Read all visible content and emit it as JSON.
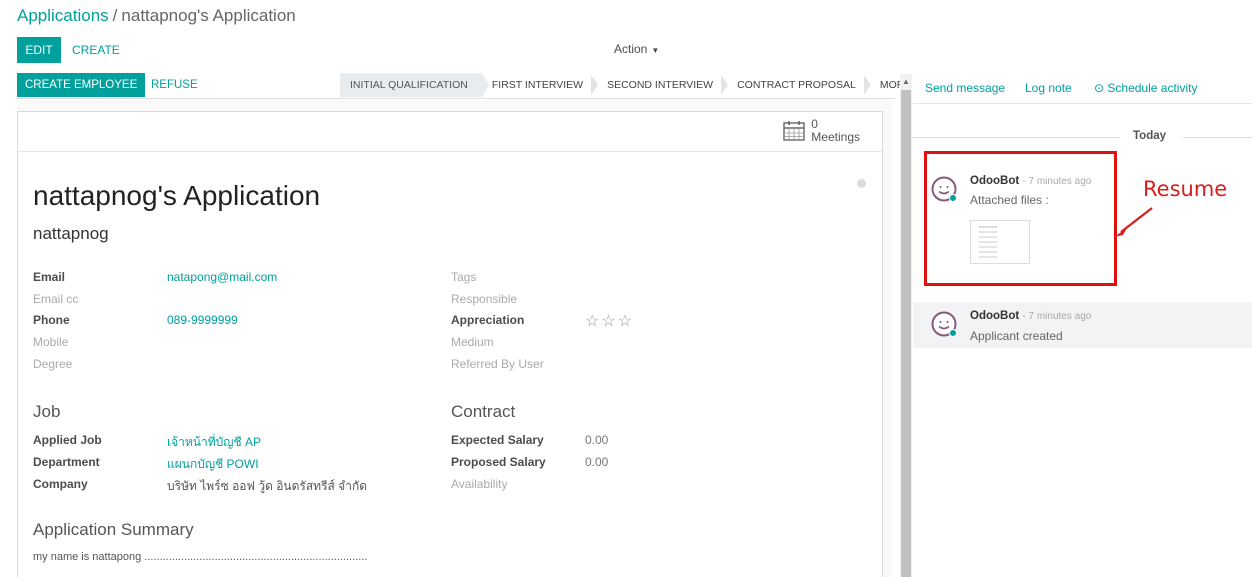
{
  "breadcrumb": {
    "parent": "Applications",
    "separator": "/",
    "current": "nattapnog's Application"
  },
  "control_panel": {
    "edit_label": "EDIT",
    "create_label": "CREATE",
    "action_label": "Action"
  },
  "statusbar": {
    "create_employee_label": "CREATE EMPLOYEE",
    "refuse_label": "REFUSE",
    "stages": [
      {
        "label": "INITIAL QUALIFICATION",
        "active": true
      },
      {
        "label": "FIRST INTERVIEW",
        "active": false
      },
      {
        "label": "SECOND INTERVIEW",
        "active": false
      },
      {
        "label": "CONTRACT PROPOSAL",
        "active": false
      }
    ],
    "more_label": "MORE"
  },
  "smart_button": {
    "count": "0",
    "label": "Meetings"
  },
  "form": {
    "title": "nattapnog's Application",
    "partner_name": "nattapnog",
    "left_fields": [
      {
        "label": "Email",
        "value": "natapong@mail.com"
      },
      {
        "label": "Email cc",
        "value": ""
      },
      {
        "label": "Phone",
        "value": "089-9999999"
      },
      {
        "label": "Mobile",
        "value": ""
      },
      {
        "label": "Degree",
        "value": ""
      }
    ],
    "right_fields": [
      {
        "label": "Tags",
        "value": ""
      },
      {
        "label": "Responsible",
        "value": ""
      },
      {
        "label": "Appreciation",
        "value": "☆☆☆"
      },
      {
        "label": "Medium",
        "value": ""
      },
      {
        "label": "Referred By User",
        "value": ""
      }
    ],
    "job_section": {
      "title": "Job",
      "fields": [
        {
          "label": "Applied Job",
          "value": "เจ้าหน้าที่บัญชี AP"
        },
        {
          "label": "Department",
          "value": "แผนกบัญชี POWI"
        },
        {
          "label": "Company",
          "value": "บริษัท ไพร์ซ ออฟ วู้ด อินดรัสทรีส์ จำกัด"
        }
      ]
    },
    "contract_section": {
      "title": "Contract",
      "fields": [
        {
          "label": "Expected Salary",
          "value": "0.00"
        },
        {
          "label": "Proposed Salary",
          "value": "0.00"
        },
        {
          "label": "Availability",
          "value": ""
        }
      ]
    },
    "summary": {
      "title": "Application Summary",
      "text": "my name is nattapong ........................................................................."
    }
  },
  "chatter": {
    "send_message": "Send message",
    "log_note": "Log note",
    "schedule_activity": "Schedule activity",
    "date_separator": "Today",
    "messages": [
      {
        "author": "OdooBot",
        "when": "- 7 minutes ago",
        "body": "Attached files :"
      },
      {
        "author": "OdooBot",
        "when": "- 7 minutes ago",
        "body": "Applicant created"
      }
    ],
    "annotation": "Resume"
  },
  "colors": {
    "primary": "#00a09d",
    "annotation_red": "#e01010",
    "avatar_purple": "#875a7b"
  }
}
